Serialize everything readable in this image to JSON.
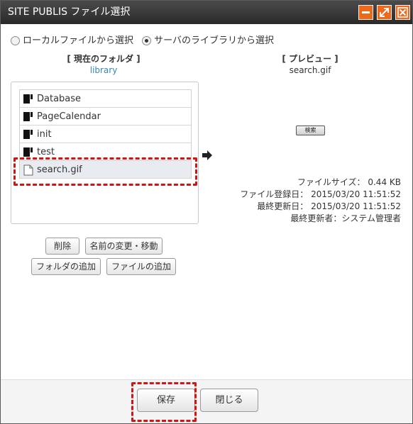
{
  "window": {
    "title": "SITE PUBLIS ファイル選択",
    "accent_color": "#ee6a1a",
    "controls": [
      "minimize-icon",
      "maximize-icon",
      "close-icon"
    ]
  },
  "source": {
    "local_label": "ローカルファイルから選択",
    "server_label": "サーバのライブラリから選択",
    "selected": "server"
  },
  "current_folder": {
    "heading": "[ 現在のフォルダ ]",
    "name": "library"
  },
  "files": [
    {
      "name": "Database",
      "icon": "folder-icon"
    },
    {
      "name": "PageCalendar",
      "icon": "folder-icon"
    },
    {
      "name": "init",
      "icon": "folder-icon"
    },
    {
      "name": "test",
      "icon": "folder-icon"
    },
    {
      "name": "search.gif",
      "icon": "file-icon",
      "selected": true
    }
  ],
  "preview": {
    "heading": "[ プレビュー ]",
    "filename": "search.gif",
    "image_text": "検索",
    "size": "ファイルサイズ： 0.44 KB",
    "registered": "ファイル登録日： 2015/03/20 11:51:52",
    "updated": "最終更新日： 2015/03/20 11:51:52",
    "updated_by": "最終更新者：システム管理者"
  },
  "actions": {
    "delete": "削除",
    "rename_move": "名前の変更・移動",
    "add_folder": "フォルダの追加",
    "add_file": "ファイルの追加"
  },
  "footer": {
    "save": "保存",
    "close": "閉じる"
  },
  "highlight_color": "#d11515"
}
